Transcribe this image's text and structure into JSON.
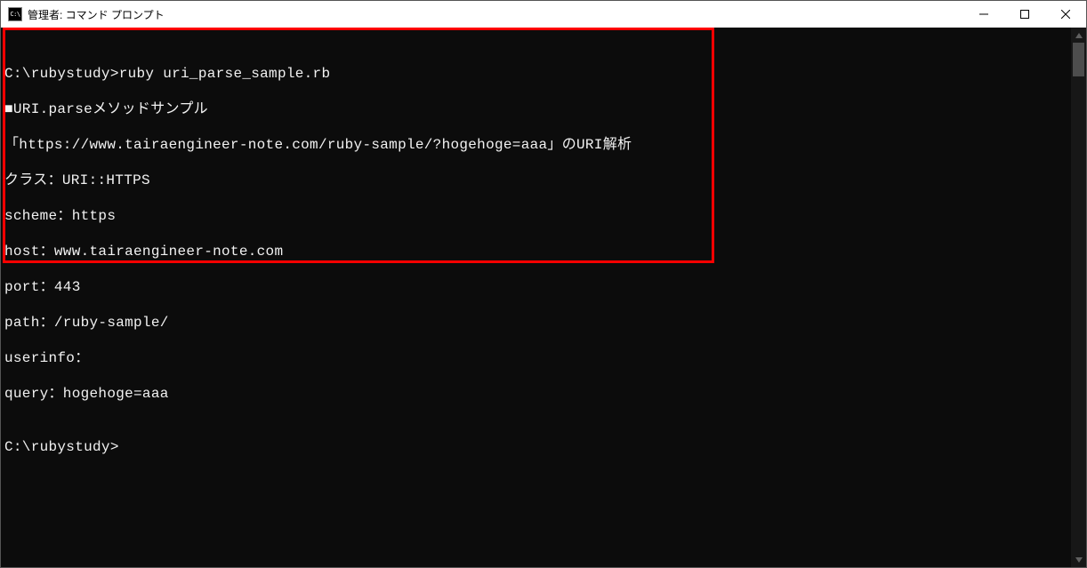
{
  "window": {
    "title": "管理者: コマンド プロンプト"
  },
  "terminal": {
    "lines": [
      "",
      "C:\\rubystudy>ruby uri_parse_sample.rb",
      "■URI.parseメソッドサンプル",
      "「https://www.tairaengineer-note.com/ruby-sample/?hogehoge=aaa」のURI解析",
      "クラス：URI::HTTPS",
      "scheme：https",
      "host：www.tairaengineer-note.com",
      "port：443",
      "path：/ruby-sample/",
      "userinfo：",
      "query：hogehoge=aaa",
      "",
      "C:\\rubystudy>"
    ]
  }
}
